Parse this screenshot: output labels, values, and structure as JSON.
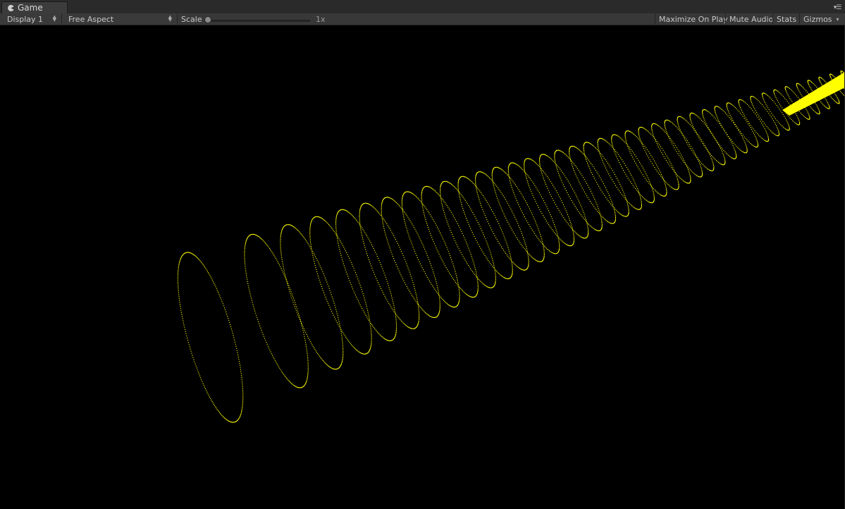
{
  "tab": {
    "label": "Game",
    "icon": "pacman-icon",
    "menu_icon": "tab-menu-icon"
  },
  "toolbar": {
    "display": "Display 1",
    "aspect": "Free Aspect",
    "scale_label": "Scale",
    "scale_value": "1x",
    "scale_fraction": 0.0,
    "maximize": "Maximize On Play",
    "mute": "Mute Audio",
    "stats": "Stats",
    "gizmos": "Gizmos"
  },
  "scene": {
    "background": "#000000",
    "point_color": "#ffff00",
    "ring_count": 40
  },
  "colors": {
    "panel": "#383838",
    "tabbar": "#2a2a2a",
    "text": "#c8c8c8"
  }
}
